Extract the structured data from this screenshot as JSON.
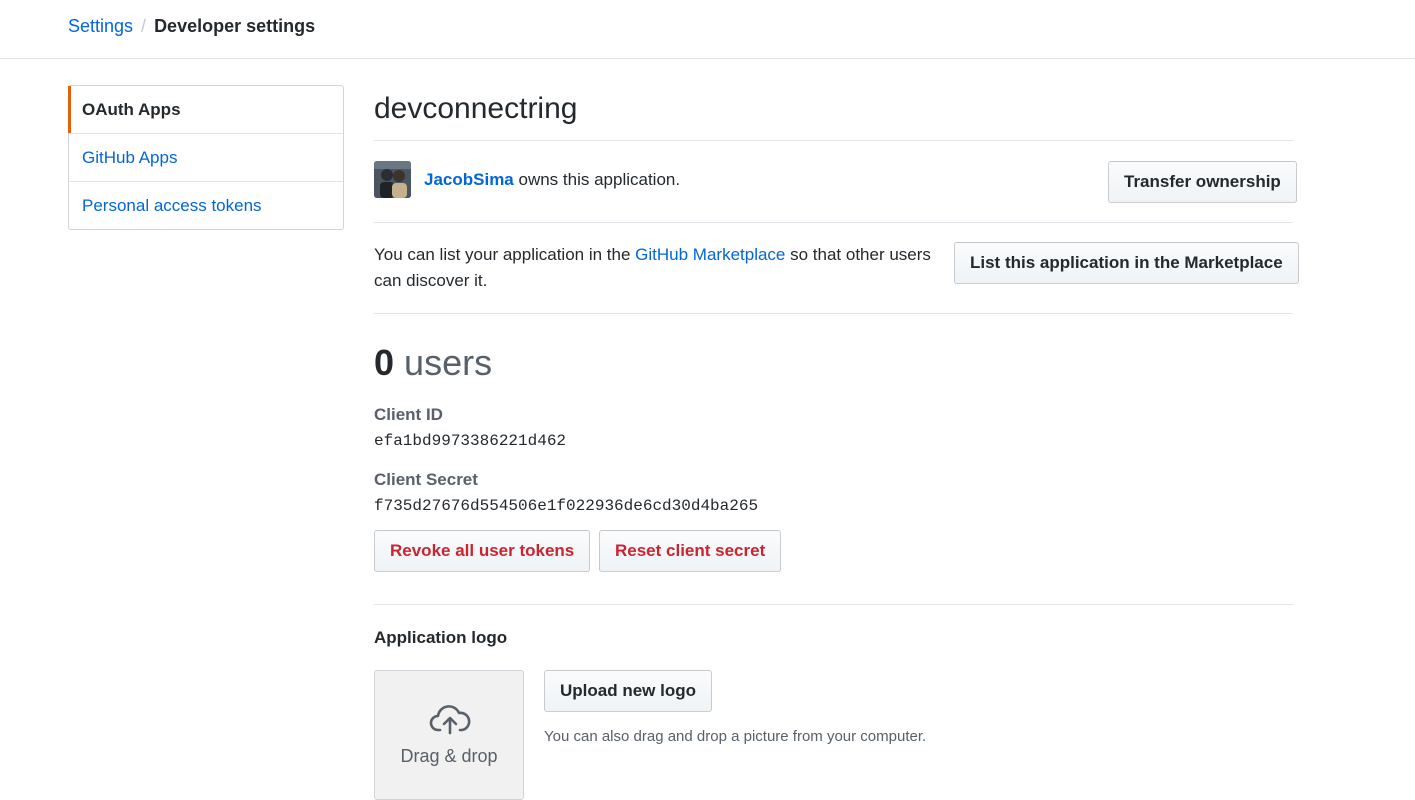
{
  "breadcrumb": {
    "parent": "Settings",
    "separator": "/",
    "current": "Developer settings"
  },
  "sidebar": {
    "items": [
      {
        "label": "OAuth Apps",
        "selected": true
      },
      {
        "label": "GitHub Apps",
        "selected": false
      },
      {
        "label": "Personal access tokens",
        "selected": false
      }
    ]
  },
  "app": {
    "name": "devconnectring",
    "owner": "JacobSima",
    "owner_suffix": " owns this application.",
    "transfer_button": "Transfer ownership"
  },
  "marketplace": {
    "text_before": "You can list your application in the ",
    "link": "GitHub Marketplace",
    "text_after": " so that other users can discover it.",
    "button": "List this application in the Marketplace"
  },
  "users": {
    "count": "0",
    "unit": "users"
  },
  "credentials": {
    "client_id_label": "Client ID",
    "client_id": "efa1bd9973386221d462",
    "client_secret_label": "Client Secret",
    "client_secret": "f735d27676d554506e1f022936de6cd30d4ba265",
    "revoke_button": "Revoke all user tokens",
    "reset_button": "Reset client secret"
  },
  "logo": {
    "heading": "Application logo",
    "dropzone_label": "Drag & drop",
    "upload_button": "Upload new logo",
    "upload_note": "You can also drag and drop a picture from your computer."
  },
  "colors": {
    "link": "#0366d6",
    "selected_accent": "#e36209",
    "danger": "#cb2431"
  }
}
